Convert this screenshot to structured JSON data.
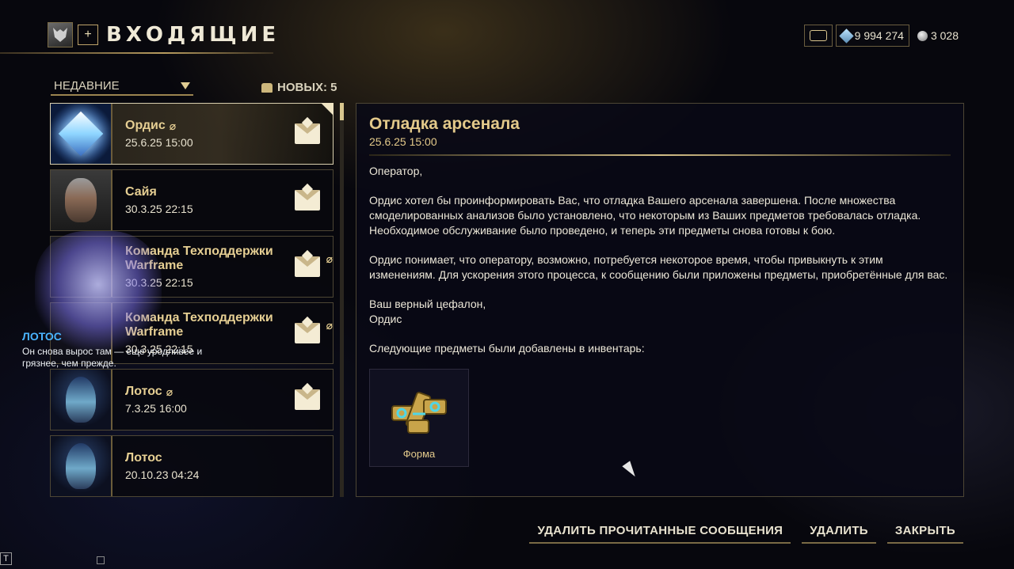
{
  "header": {
    "title": "ВХОДЯЩИЕ",
    "plus_label": "+"
  },
  "currency": {
    "platinum": "9 994 274",
    "credits": "3 028"
  },
  "list": {
    "filter_label": "НЕДАВНИЕ",
    "new_count_label": "НОВЫХ: 5",
    "items": [
      {
        "sender": "Ордис",
        "date": "25.6.25 15:00",
        "attachment": true,
        "icon": "diamond-portrait"
      },
      {
        "sender": "Сайя",
        "date": "30.3.25 22:15",
        "attachment": false,
        "icon": "saya-portrait"
      },
      {
        "sender": "Команда Техподдержки Warframe",
        "date": "30.3.25 22:15",
        "attachment": true,
        "icon": "support-portrait"
      },
      {
        "sender": "Команда Техподдержки Warframe",
        "date": "30.3.25 22:15",
        "attachment": true,
        "icon": "support-portrait"
      },
      {
        "sender": "Лотос",
        "date": "7.3.25 16:00",
        "attachment": true,
        "icon": "lotus-portrait"
      },
      {
        "sender": "Лотос",
        "date": "20.10.23 04:24",
        "attachment": false,
        "icon": "lotus-portrait"
      }
    ]
  },
  "overlay": {
    "name": "ЛОТОС",
    "text": "Он снова вырос там — еще уродливее и грязнее, чем прежде."
  },
  "detail": {
    "title": "Отладка арсенала",
    "date": "25.6.25 15:00",
    "paragraphs": [
      "Оператор,",
      "Ордис хотел бы проинформировать Вас, что отладка Вашего арсенала завершена. После множества смоделированных анализов было установлено, что некоторым из Ваших предметов требовалась отладка. Необходимое обслуживание было проведено, и теперь эти предметы снова готовы к бою.",
      "Ордис понимает, что оператору, возможно, потребуется некоторое время, чтобы привыкнуть к этим изменениям. Для ускорения этого процесса, к сообщению были приложены предметы, приобретённые для вас.",
      "Ваш верный цефалон,\nОрдис",
      "Следующие предметы были добавлены в инвентарь:"
    ],
    "reward_label": "Форма"
  },
  "actions": {
    "delete_read": "УДАЛИТЬ ПРОЧИТАННЫЕ СООБЩЕНИЯ",
    "delete": "УДАЛИТЬ",
    "close": "ЗАКРЫТЬ"
  },
  "corner_label": "T"
}
